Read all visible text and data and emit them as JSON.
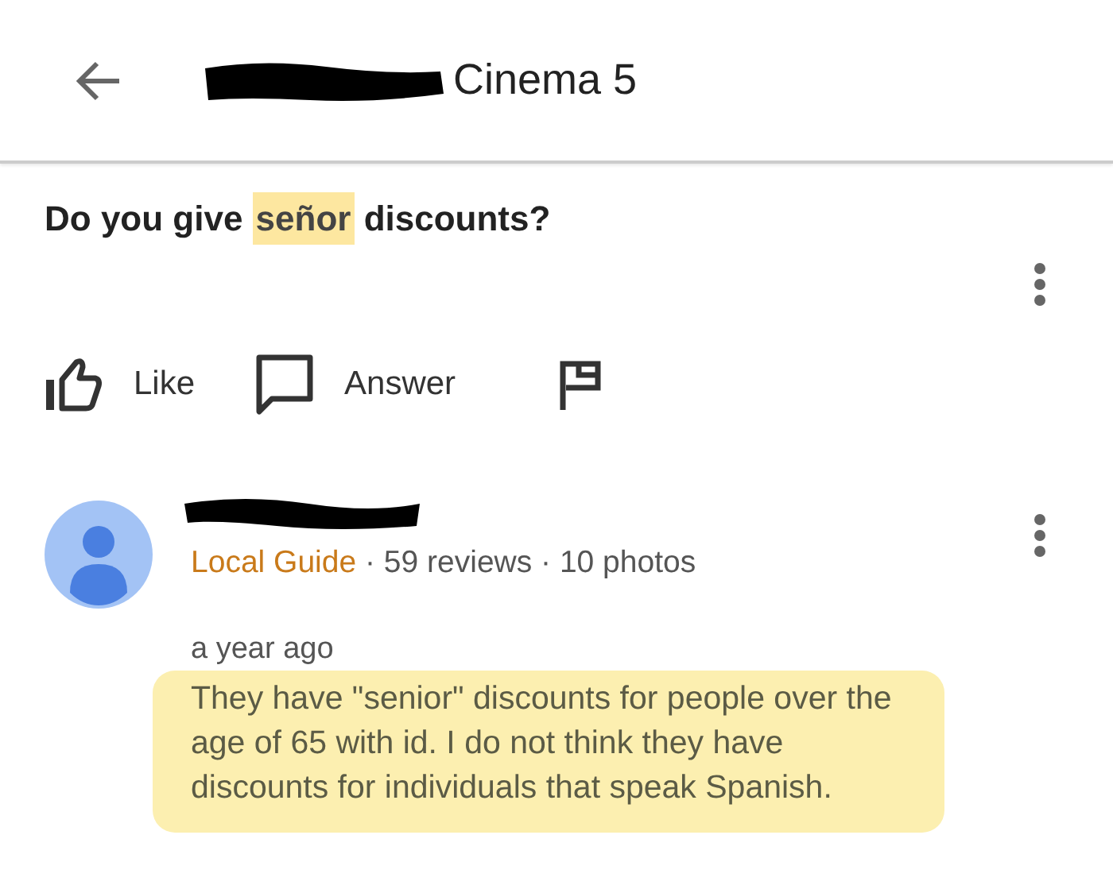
{
  "header": {
    "title": "Cinema 5"
  },
  "question": {
    "parts": [
      {
        "text": "Do you give ",
        "highlighted": false
      },
      {
        "text": "señor",
        "highlighted": true
      },
      {
        "text": " discounts?",
        "highlighted": false
      }
    ]
  },
  "actions": [
    {
      "kind": "like",
      "label": "Like"
    },
    {
      "kind": "answer",
      "label": "Answer"
    },
    {
      "kind": "flag"
    }
  ],
  "answer": {
    "badge": "Local Guide",
    "stats": "· 59 reviews · 10 photos",
    "time": "a year ago",
    "text": "They have \"senior\" discounts for people over the age of 65 with id. I do not think they have discounts for individuals that speak Spanish.",
    "highlighted": true
  }
}
